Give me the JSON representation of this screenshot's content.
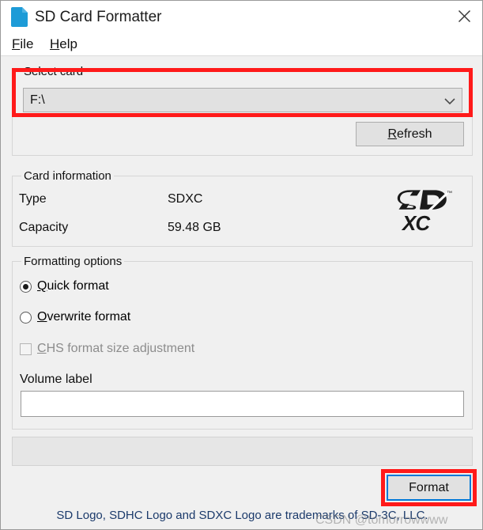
{
  "window": {
    "title": "SD Card Formatter",
    "app_icon": "sd-card-icon",
    "close_label": "✕",
    "accent_color": "#0078d7",
    "annotation_color": "#ff1a1a"
  },
  "menubar": {
    "items": [
      {
        "label": "File",
        "accel": "F"
      },
      {
        "label": "Help",
        "accel": "H"
      }
    ]
  },
  "select_card": {
    "legend": "Select card",
    "selected_value": "F:\\",
    "dropdown_icon": "chevron-down-icon",
    "refresh_label": "Refresh",
    "refresh_accel": "R"
  },
  "card_information": {
    "legend": "Card information",
    "rows": [
      {
        "label": "Type",
        "value": "SDXC"
      },
      {
        "label": "Capacity",
        "value": "59.48 GB"
      }
    ],
    "logo": "sdxc-logo",
    "logo_text_top": "SD",
    "logo_text_bottom": "XC",
    "logo_trademark": "™"
  },
  "formatting_options": {
    "legend": "Formatting options",
    "options": [
      {
        "label": "Quick format",
        "accel": "Q",
        "type": "radio",
        "checked": true,
        "disabled": false
      },
      {
        "label": "Overwrite format",
        "accel": "O",
        "type": "radio",
        "checked": false,
        "disabled": false
      },
      {
        "label": "CHS format size adjustment",
        "accel": "C",
        "type": "checkbox",
        "checked": false,
        "disabled": true
      }
    ],
    "volume_label_caption": "Volume label",
    "volume_label_value": "",
    "volume_label_placeholder": ""
  },
  "message_panel": {
    "text": ""
  },
  "actions": {
    "format_label": "Format"
  },
  "footer": {
    "text": "SD Logo, SDHC Logo and SDXC Logo are trademarks of SD-3C, LLC."
  },
  "watermark": {
    "text": "CSDN @tomorrowwww"
  }
}
